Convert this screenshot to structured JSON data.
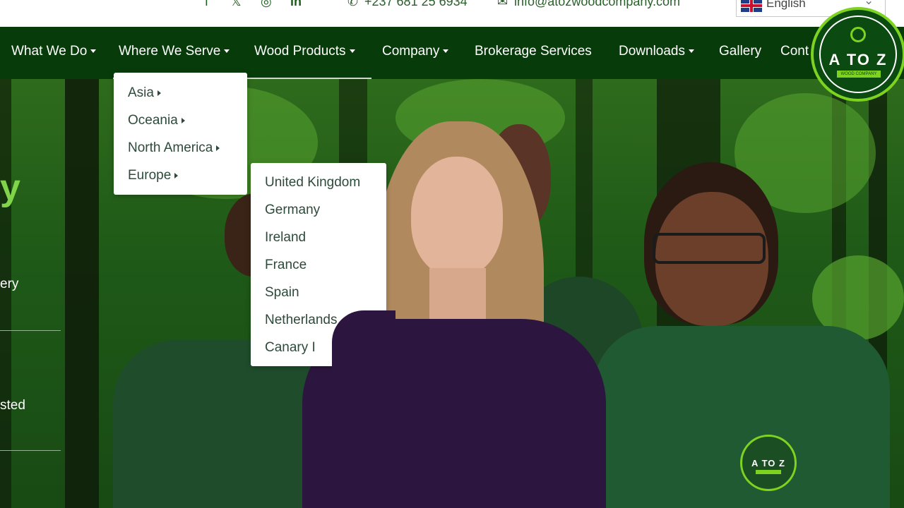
{
  "header": {
    "social": [
      "f",
      "𝕏",
      "◎",
      "in"
    ],
    "phone": "+237 681 25 6934",
    "email": "info@atozwoodcompany.com",
    "language": "English"
  },
  "nav": {
    "items": [
      {
        "label": "What We Do",
        "dropdown": true
      },
      {
        "label": "Where We Serve",
        "dropdown": true
      },
      {
        "label": "Wood Products",
        "dropdown": true
      },
      {
        "label": "Company",
        "dropdown": true
      },
      {
        "label": "Brokerage Services",
        "dropdown": false
      },
      {
        "label": "Downloads",
        "dropdown": true
      },
      {
        "label": "Gallery",
        "dropdown": false
      },
      {
        "label": "Cont",
        "dropdown": false
      }
    ]
  },
  "where_we_serve_menu": [
    "Asia",
    "Oceania",
    "North America",
    "Europe"
  ],
  "europe_submenu": [
    "United Kingdom",
    "Germany",
    "Ireland",
    "France",
    "Spain",
    "Netherlands",
    "Canary I"
  ],
  "hero": {
    "big_letter": "y",
    "fragment_1": "ery",
    "fragment_2": "sted"
  },
  "logo": {
    "text": "A TO Z",
    "subtext": "WOOD COMPANY"
  },
  "colors": {
    "nav_bg": "#073b0a",
    "accent": "#7ed321"
  }
}
